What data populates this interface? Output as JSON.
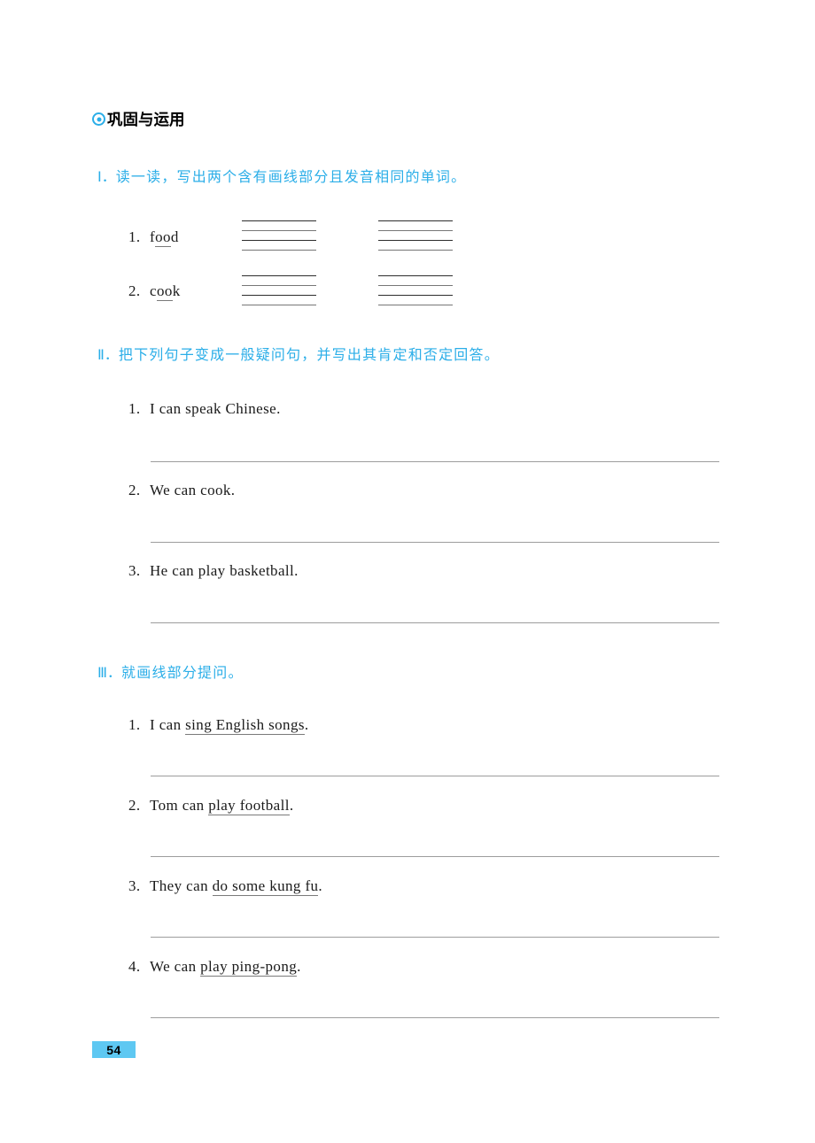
{
  "header": {
    "bullet_icon": "circled-dot-icon",
    "title": "巩固与运用"
  },
  "sections": [
    {
      "numeral": "Ⅰ",
      "separator": "．",
      "instruction": "读一读，写出两个含有画线部分且发音相同的单词。",
      "items": [
        {
          "num": "1.",
          "pre": "f",
          "underlined": "oo",
          "post": "d"
        },
        {
          "num": "2.",
          "pre": "c",
          "underlined": "oo",
          "post": "k"
        }
      ]
    },
    {
      "numeral": "Ⅱ",
      "separator": "．",
      "instruction": "把下列句子变成一般疑问句，并写出其肯定和否定回答。",
      "items": [
        {
          "num": "1.",
          "text": "I can speak Chinese."
        },
        {
          "num": "2.",
          "text": "We can cook."
        },
        {
          "num": "3.",
          "text": "He can play basketball."
        }
      ]
    },
    {
      "numeral": "Ⅲ",
      "separator": "．",
      "instruction": "就画线部分提问。",
      "items": [
        {
          "num": "1.",
          "pre": "I can ",
          "underlined": "sing English songs",
          "post": "."
        },
        {
          "num": "2.",
          "pre": "Tom can ",
          "underlined": "play football",
          "post": "."
        },
        {
          "num": "3.",
          "pre": "They can ",
          "underlined": "do some kung fu",
          "post": "."
        },
        {
          "num": "4.",
          "pre": "We can ",
          "underlined": "play ping-pong",
          "post": "."
        }
      ]
    }
  ],
  "page_number": "54",
  "colors": {
    "instruction_blue": "#2BAEE8",
    "badge_blue": "#5EC8F2",
    "rule_gray": "#9d9d9d",
    "text_black": "#1a1a1a"
  }
}
